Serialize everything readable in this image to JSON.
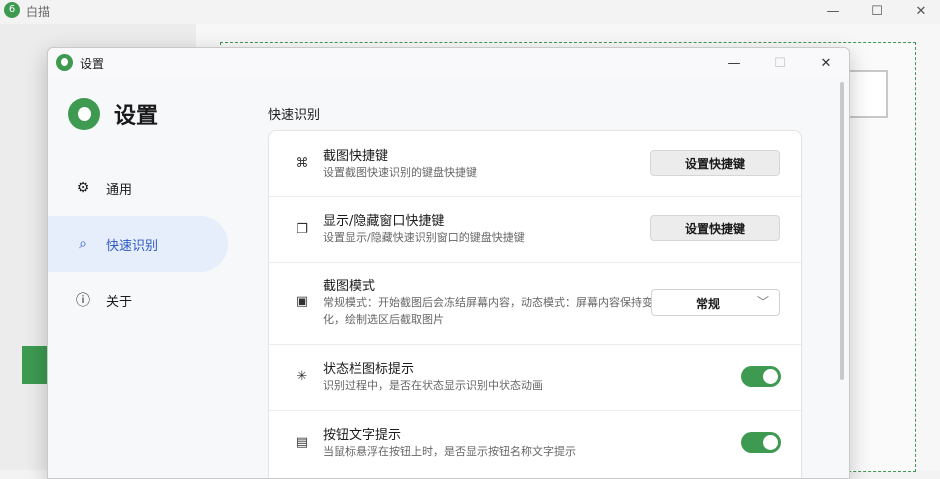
{
  "main_window": {
    "title": "白描",
    "logo_glyph": "6",
    "minimize_glyph": "—",
    "maximize_glyph": "☐",
    "close_glyph": "✕"
  },
  "dialog": {
    "title": "设置",
    "minimize_glyph": "—",
    "maximize_glyph": "☐",
    "close_glyph": "✕"
  },
  "sidebar": {
    "title": "设置",
    "items": [
      {
        "label": "通用",
        "icon": "gear-icon",
        "glyph": "⚙",
        "active": false
      },
      {
        "label": "快速识别",
        "icon": "scan-doc-icon",
        "glyph": "⌕",
        "active": true
      },
      {
        "label": "关于",
        "icon": "info-icon",
        "glyph": "ⓘ",
        "active": false
      }
    ]
  },
  "content": {
    "section_title": "快速识别",
    "rows": [
      {
        "title": "截图快捷键",
        "desc": "设置截图快速识别的键盘快捷键",
        "icon": "command-key-icon",
        "glyph": "⌘",
        "control": "button",
        "button_label": "设置快捷键"
      },
      {
        "title": "显示/隐藏窗口快捷键",
        "desc": "设置显示/隐藏快速识别窗口的键盘快捷键",
        "icon": "windows-icon",
        "glyph": "❐",
        "control": "button",
        "button_label": "设置快捷键"
      },
      {
        "title": "截图模式",
        "desc": "常规模式：开始截图后会冻结屏幕内容，动态模式：屏幕内容保持变化，绘制选区后截取图片",
        "icon": "image-icon",
        "glyph": "▣",
        "control": "select",
        "select_value": "常规",
        "select_chevron": "﹀"
      },
      {
        "title": "状态栏图标提示",
        "desc": "识别过程中，是否在状态显示识别中状态动画",
        "icon": "spinner-icon",
        "glyph": "✳",
        "control": "toggle",
        "toggle_on": true
      },
      {
        "title": "按钮文字提示",
        "desc": "当鼠标悬浮在按钮上时，是否显示按钮名称文字提示",
        "icon": "message-icon",
        "glyph": "▤",
        "control": "toggle",
        "toggle_on": true
      }
    ]
  },
  "colors": {
    "accent_green": "#3d9a50",
    "nav_active_bg": "#e6edfb",
    "nav_active_text": "#2d5bc7"
  }
}
